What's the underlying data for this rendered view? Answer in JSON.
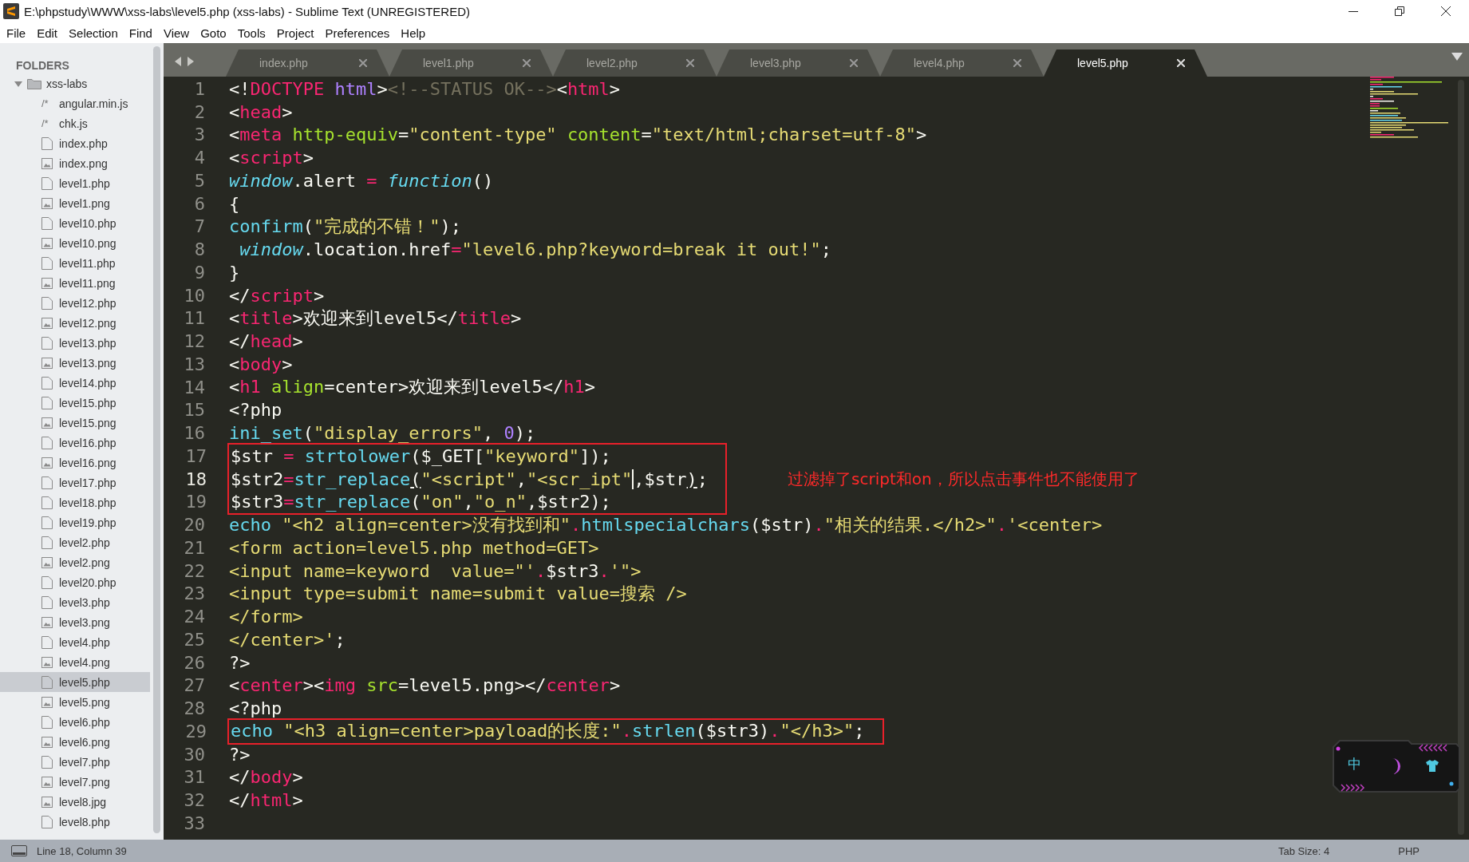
{
  "window": {
    "title": "E:\\phpstudy\\WWW\\xss-labs\\level5.php (xss-labs) - Sublime Text (UNREGISTERED)"
  },
  "menu": [
    "File",
    "Edit",
    "Selection",
    "Find",
    "View",
    "Goto",
    "Tools",
    "Project",
    "Preferences",
    "Help"
  ],
  "sidebar": {
    "header": "FOLDERS",
    "folders": [
      {
        "name": "xss-labs",
        "expanded": true,
        "children": [
          {
            "name": "angular.min.js",
            "kind": "script",
            "glyph": "/*",
            "selected": false
          },
          {
            "name": "chk.js",
            "kind": "script",
            "glyph": "/*",
            "selected": false
          },
          {
            "name": "index.php",
            "kind": "file",
            "selected": false
          },
          {
            "name": "index.png",
            "kind": "image",
            "selected": false
          },
          {
            "name": "level1.php",
            "kind": "file",
            "selected": false
          },
          {
            "name": "level1.png",
            "kind": "image",
            "selected": false
          },
          {
            "name": "level10.php",
            "kind": "file",
            "selected": false
          },
          {
            "name": "level10.png",
            "kind": "image",
            "selected": false
          },
          {
            "name": "level11.php",
            "kind": "file",
            "selected": false
          },
          {
            "name": "level11.png",
            "kind": "image",
            "selected": false
          },
          {
            "name": "level12.php",
            "kind": "file",
            "selected": false
          },
          {
            "name": "level12.png",
            "kind": "image",
            "selected": false
          },
          {
            "name": "level13.php",
            "kind": "file",
            "selected": false
          },
          {
            "name": "level13.png",
            "kind": "image",
            "selected": false
          },
          {
            "name": "level14.php",
            "kind": "file",
            "selected": false
          },
          {
            "name": "level15.php",
            "kind": "file",
            "selected": false
          },
          {
            "name": "level15.png",
            "kind": "image",
            "selected": false
          },
          {
            "name": "level16.php",
            "kind": "file",
            "selected": false
          },
          {
            "name": "level16.png",
            "kind": "image",
            "selected": false
          },
          {
            "name": "level17.php",
            "kind": "file",
            "selected": false
          },
          {
            "name": "level18.php",
            "kind": "file",
            "selected": false
          },
          {
            "name": "level19.php",
            "kind": "file",
            "selected": false
          },
          {
            "name": "level2.php",
            "kind": "file",
            "selected": false
          },
          {
            "name": "level2.png",
            "kind": "image",
            "selected": false
          },
          {
            "name": "level20.php",
            "kind": "file",
            "selected": false
          },
          {
            "name": "level3.php",
            "kind": "file",
            "selected": false
          },
          {
            "name": "level3.png",
            "kind": "image",
            "selected": false
          },
          {
            "name": "level4.php",
            "kind": "file",
            "selected": false
          },
          {
            "name": "level4.png",
            "kind": "image",
            "selected": false
          },
          {
            "name": "level5.php",
            "kind": "file",
            "selected": true
          },
          {
            "name": "level5.png",
            "kind": "image",
            "selected": false
          },
          {
            "name": "level6.php",
            "kind": "file",
            "selected": false
          },
          {
            "name": "level6.png",
            "kind": "image",
            "selected": false
          },
          {
            "name": "level7.php",
            "kind": "file",
            "selected": false
          },
          {
            "name": "level7.png",
            "kind": "image",
            "selected": false
          },
          {
            "name": "level8.jpg",
            "kind": "image",
            "selected": false
          },
          {
            "name": "level8.php",
            "kind": "file",
            "selected": false
          }
        ]
      }
    ]
  },
  "tabs": [
    {
      "label": "index.php",
      "selected": false
    },
    {
      "label": "level1.php",
      "selected": false
    },
    {
      "label": "level2.php",
      "selected": false
    },
    {
      "label": "level3.php",
      "selected": false
    },
    {
      "label": "level4.php",
      "selected": false
    },
    {
      "label": "level5.php",
      "selected": true
    }
  ],
  "code": {
    "blocks": [
      {
        "kind": "plain",
        "lines": [
          {
            "number": "1",
            "current": false,
            "tokens": [
              {
                "t": "<!",
                "kind": "plain"
              },
              {
                "t": "DOCTYPE ",
                "kind": "tag"
              },
              {
                "t": "html",
                "kind": "number"
              },
              {
                "t": ">",
                "kind": "plain"
              },
              {
                "t": "<!--STATUS OK-->",
                "kind": "comment"
              },
              {
                "t": "<",
                "kind": "plain"
              },
              {
                "t": "html",
                "kind": "tag"
              },
              {
                "t": ">",
                "kind": "plain"
              }
            ]
          },
          {
            "number": "2",
            "current": false,
            "tokens": [
              {
                "t": "<",
                "kind": "plain"
              },
              {
                "t": "head",
                "kind": "tag"
              },
              {
                "t": ">",
                "kind": "plain"
              }
            ]
          },
          {
            "number": "3",
            "current": false,
            "tokens": [
              {
                "t": "<",
                "kind": "plain"
              },
              {
                "t": "meta ",
                "kind": "tag"
              },
              {
                "t": "http-equiv",
                "kind": "attr"
              },
              {
                "t": "=",
                "kind": "plain"
              },
              {
                "t": "\"content-type\" ",
                "kind": "string"
              },
              {
                "t": "content",
                "kind": "attr"
              },
              {
                "t": "=",
                "kind": "plain"
              },
              {
                "t": "\"text/html;charset=utf-8\"",
                "kind": "string"
              },
              {
                "t": ">",
                "kind": "plain"
              }
            ]
          },
          {
            "number": "4",
            "current": false,
            "tokens": [
              {
                "t": "<",
                "kind": "plain"
              },
              {
                "t": "script",
                "kind": "tag"
              },
              {
                "t": ">",
                "kind": "plain"
              }
            ]
          },
          {
            "number": "5",
            "current": false,
            "tokens": [
              {
                "t": "window",
                "kind": "storage"
              },
              {
                "t": ".alert ",
                "kind": "plain"
              },
              {
                "t": "= ",
                "kind": "tag"
              },
              {
                "t": "function",
                "kind": "storage"
              },
              {
                "t": "()",
                "kind": "plain"
              }
            ]
          },
          {
            "number": "6",
            "current": false,
            "tokens": [
              {
                "t": "{",
                "kind": "plain"
              }
            ]
          },
          {
            "number": "7",
            "current": false,
            "tokens": [
              {
                "t": "confirm",
                "kind": "func"
              },
              {
                "t": "(",
                "kind": "plain"
              },
              {
                "t": "\"完成的不错！\"",
                "kind": "string"
              },
              {
                "t": ");",
                "kind": "plain"
              }
            ]
          },
          {
            "number": "8",
            "current": false,
            "tokens": [
              {
                "t": " window",
                "kind": "storage"
              },
              {
                "t": ".location.href",
                "kind": "plain"
              },
              {
                "t": "=",
                "kind": "tag"
              },
              {
                "t": "\"level6.php?keyword=break it out!\"",
                "kind": "string"
              },
              {
                "t": ";",
                "kind": "plain"
              }
            ]
          },
          {
            "number": "9",
            "current": false,
            "tokens": [
              {
                "t": "}",
                "kind": "plain"
              }
            ]
          },
          {
            "number": "10",
            "current": false,
            "tokens": [
              {
                "t": "</",
                "kind": "plain"
              },
              {
                "t": "script",
                "kind": "tag"
              },
              {
                "t": ">",
                "kind": "plain"
              }
            ]
          },
          {
            "number": "11",
            "current": false,
            "tokens": [
              {
                "t": "<",
                "kind": "plain"
              },
              {
                "t": "title",
                "kind": "tag"
              },
              {
                "t": ">欢迎来到level5</",
                "kind": "plain"
              },
              {
                "t": "title",
                "kind": "tag"
              },
              {
                "t": ">",
                "kind": "plain"
              }
            ]
          },
          {
            "number": "12",
            "current": false,
            "tokens": [
              {
                "t": "</",
                "kind": "plain"
              },
              {
                "t": "head",
                "kind": "tag"
              },
              {
                "t": ">",
                "kind": "plain"
              }
            ]
          },
          {
            "number": "13",
            "current": false,
            "tokens": [
              {
                "t": "<",
                "kind": "plain"
              },
              {
                "t": "body",
                "kind": "tag"
              },
              {
                "t": ">",
                "kind": "plain"
              }
            ]
          },
          {
            "number": "14",
            "current": false,
            "tokens": [
              {
                "t": "<",
                "kind": "plain"
              },
              {
                "t": "h1 ",
                "kind": "tag"
              },
              {
                "t": "align",
                "kind": "attr"
              },
              {
                "t": "=center>欢迎来到level5</",
                "kind": "plain"
              },
              {
                "t": "h1",
                "kind": "tag"
              },
              {
                "t": ">",
                "kind": "plain"
              }
            ]
          },
          {
            "number": "15",
            "current": false,
            "tokens": [
              {
                "t": "<?php",
                "kind": "plain"
              }
            ]
          },
          {
            "number": "16",
            "current": false,
            "tokens": [
              {
                "t": "ini_set",
                "kind": "func"
              },
              {
                "t": "(",
                "kind": "plain"
              },
              {
                "t": "\"display_errors\"",
                "kind": "string"
              },
              {
                "t": ", ",
                "kind": "plain"
              },
              {
                "t": "0",
                "kind": "number"
              },
              {
                "t": ");",
                "kind": "plain"
              }
            ]
          }
        ]
      },
      {
        "kind": "boxed",
        "note": "过滤掉了script和on，所以点击事件也不能使用了",
        "lines": [
          {
            "number": "17",
            "current": false,
            "tokens": [
              {
                "t": "$str ",
                "kind": "plain"
              },
              {
                "t": "= ",
                "kind": "tag"
              },
              {
                "t": "strtolower",
                "kind": "func"
              },
              {
                "t": "($_GET[",
                "kind": "plain"
              },
              {
                "t": "\"keyword\"",
                "kind": "string"
              },
              {
                "t": "]);",
                "kind": "plain"
              }
            ]
          },
          {
            "number": "18",
            "current": true,
            "tokens": [
              {
                "t": "$str2",
                "kind": "plain"
              },
              {
                "t": "=",
                "kind": "tag"
              },
              {
                "t": "str_replace",
                "kind": "func"
              },
              {
                "t": "(",
                "kind": "plain",
                "matched": true
              },
              {
                "t": "\"<script\"",
                "kind": "string"
              },
              {
                "t": ",",
                "kind": "plain"
              },
              {
                "t": "\"<scr_ipt\"",
                "kind": "string",
                "caret": true
              },
              {
                "t": ",$str",
                "kind": "plain"
              },
              {
                "t": ")",
                "kind": "plain",
                "matched": true
              },
              {
                "t": ";",
                "kind": "plain"
              }
            ]
          },
          {
            "number": "19",
            "current": false,
            "tokens": [
              {
                "t": "$str3",
                "kind": "plain"
              },
              {
                "t": "=",
                "kind": "tag"
              },
              {
                "t": "str_replace",
                "kind": "func"
              },
              {
                "t": "(",
                "kind": "plain"
              },
              {
                "t": "\"on\"",
                "kind": "string"
              },
              {
                "t": ",",
                "kind": "plain"
              },
              {
                "t": "\"o_n\"",
                "kind": "string"
              },
              {
                "t": ",$str2);",
                "kind": "plain"
              }
            ]
          }
        ]
      },
      {
        "kind": "plain",
        "lines": [
          {
            "number": "20",
            "current": false,
            "tokens": [
              {
                "t": "echo ",
                "kind": "func"
              },
              {
                "t": "\"<h2 align=center>没有找到和\"",
                "kind": "string"
              },
              {
                "t": ".",
                "kind": "tag"
              },
              {
                "t": "htmlspecialchars",
                "kind": "func"
              },
              {
                "t": "($str)",
                "kind": "plain"
              },
              {
                "t": ".",
                "kind": "tag"
              },
              {
                "t": "\"相关的结果.</h2>\"",
                "kind": "string"
              },
              {
                "t": ".",
                "kind": "tag"
              },
              {
                "t": "'<center>",
                "kind": "string"
              }
            ]
          },
          {
            "number": "21",
            "current": false,
            "tokens": [
              {
                "t": "<form action=level5.php method=GET>",
                "kind": "string"
              }
            ]
          },
          {
            "number": "22",
            "current": false,
            "tokens": [
              {
                "t": "<input name=keyword  value=\"'",
                "kind": "string"
              },
              {
                "t": ".",
                "kind": "tag"
              },
              {
                "t": "$str3",
                "kind": "plain"
              },
              {
                "t": ".",
                "kind": "tag"
              },
              {
                "t": "'\">",
                "kind": "string"
              }
            ]
          },
          {
            "number": "23",
            "current": false,
            "tokens": [
              {
                "t": "<input type=submit name=submit value=搜索 />",
                "kind": "string"
              }
            ]
          },
          {
            "number": "24",
            "current": false,
            "tokens": [
              {
                "t": "</form>",
                "kind": "string"
              }
            ]
          },
          {
            "number": "25",
            "current": false,
            "tokens": [
              {
                "t": "</center>'",
                "kind": "string"
              },
              {
                "t": ";",
                "kind": "plain"
              }
            ]
          },
          {
            "number": "26",
            "current": false,
            "tokens": [
              {
                "t": "?>",
                "kind": "plain"
              }
            ]
          },
          {
            "number": "27",
            "current": false,
            "tokens": [
              {
                "t": "<",
                "kind": "plain"
              },
              {
                "t": "center",
                "kind": "tag"
              },
              {
                "t": "><",
                "kind": "plain"
              },
              {
                "t": "img ",
                "kind": "tag"
              },
              {
                "t": "src",
                "kind": "attr"
              },
              {
                "t": "=level5.png></",
                "kind": "plain"
              },
              {
                "t": "center",
                "kind": "tag"
              },
              {
                "t": ">",
                "kind": "plain"
              }
            ]
          },
          {
            "number": "28",
            "current": false,
            "tokens": [
              {
                "t": "<?php",
                "kind": "plain"
              }
            ]
          }
        ]
      },
      {
        "kind": "boxed",
        "lines": [
          {
            "number": "29",
            "current": false,
            "tokens": [
              {
                "t": "echo ",
                "kind": "func"
              },
              {
                "t": "\"<h3 align=center>payload的长度:\"",
                "kind": "string"
              },
              {
                "t": ".",
                "kind": "tag"
              },
              {
                "t": "strlen",
                "kind": "func"
              },
              {
                "t": "($str3)",
                "kind": "plain"
              },
              {
                "t": ".",
                "kind": "tag"
              },
              {
                "t": "\"</h3>\"",
                "kind": "string"
              },
              {
                "t": ";",
                "kind": "plain"
              }
            ]
          }
        ]
      },
      {
        "kind": "plain",
        "lines": [
          {
            "number": "30",
            "current": false,
            "tokens": [
              {
                "t": "?>",
                "kind": "plain"
              }
            ]
          },
          {
            "number": "31",
            "current": false,
            "tokens": [
              {
                "t": "</",
                "kind": "plain"
              },
              {
                "t": "body",
                "kind": "tag"
              },
              {
                "t": ">",
                "kind": "plain"
              }
            ]
          },
          {
            "number": "32",
            "current": false,
            "tokens": [
              {
                "t": "</",
                "kind": "plain"
              },
              {
                "t": "html",
                "kind": "tag"
              },
              {
                "t": ">",
                "kind": "plain"
              }
            ]
          },
          {
            "number": "33",
            "current": false
          }
        ]
      }
    ]
  },
  "ime": {
    "label": "中"
  },
  "status_bar": {
    "position": "Line 18, Column 39",
    "tab_size": "Tab Size: 4",
    "syntax": "PHP"
  }
}
